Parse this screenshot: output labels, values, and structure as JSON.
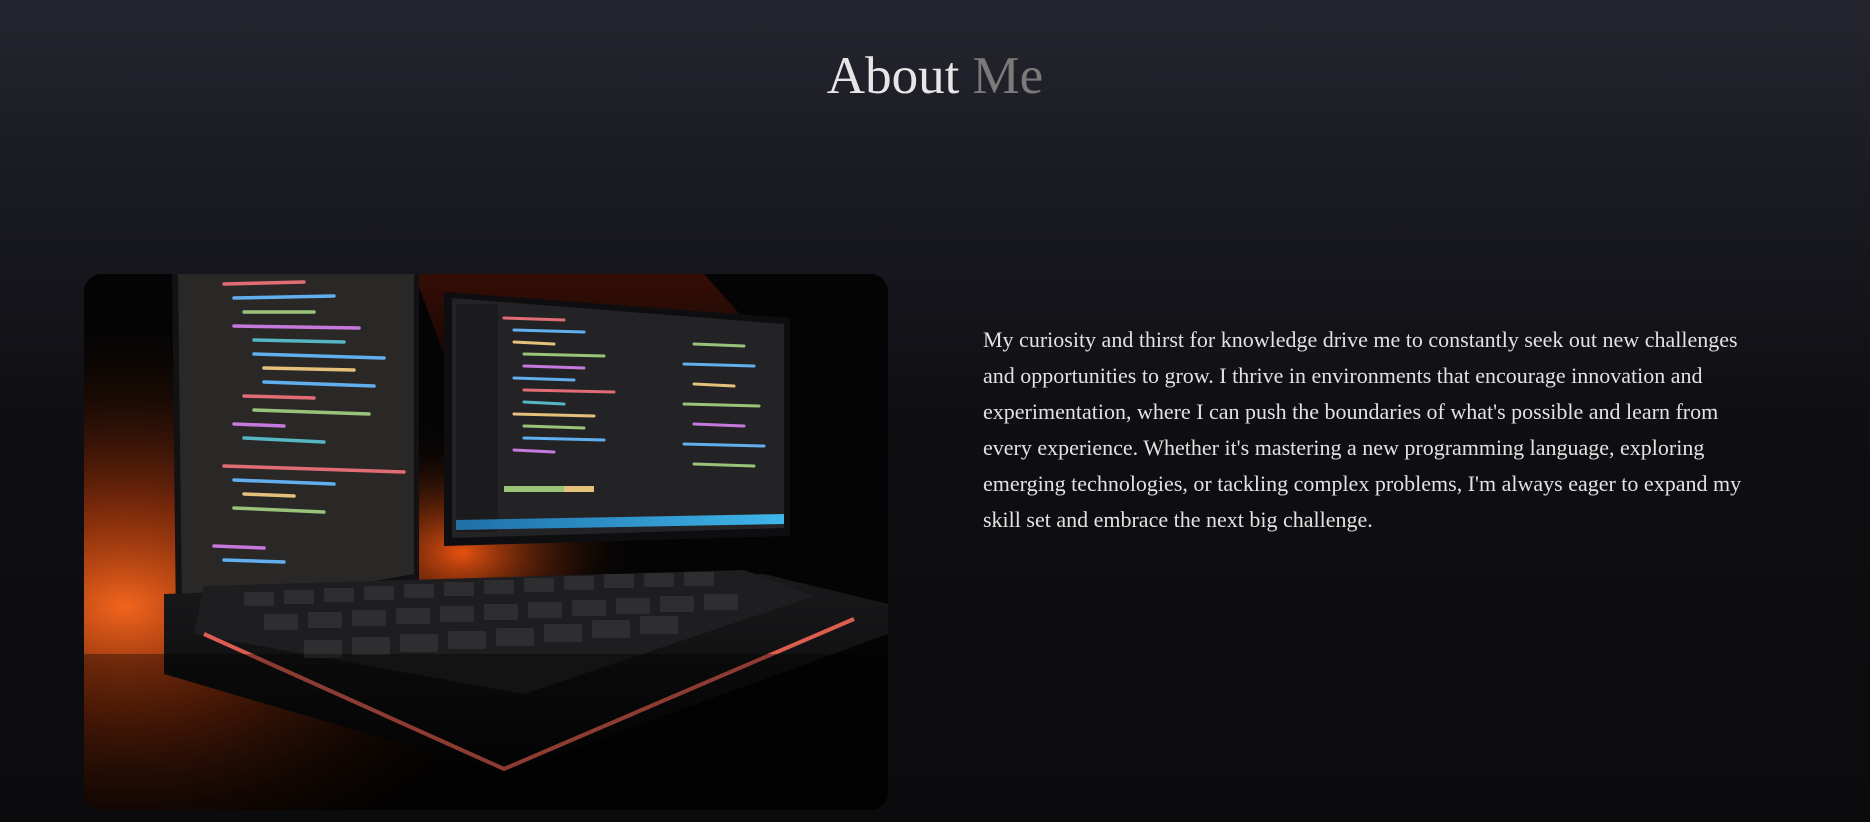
{
  "section": {
    "title_main": "About",
    "title_accent": "Me",
    "bio": "My curiosity and thirst for knowledge drive me to constantly seek out new challenges and opportunities to grow. I thrive in environments that encourage innovation and experimentation, where I can push the boundaries of what's possible and learn from every experience. Whether it's mastering a new programming language, exploring emerging technologies, or tackling complex problems, I'm always eager to expand my skill set and embrace the next big challenge."
  },
  "colors": {
    "title": "#e6e6e6",
    "title_accent": "#7a7a7a",
    "text": "#e2e2e2",
    "background_top": "#25252f",
    "background_bottom": "#0b0b0d",
    "photo_glow": "#ff5a1a"
  },
  "image": {
    "icon": "workstation-photo",
    "subject": "two monitors with code and a backlit keyboard"
  }
}
